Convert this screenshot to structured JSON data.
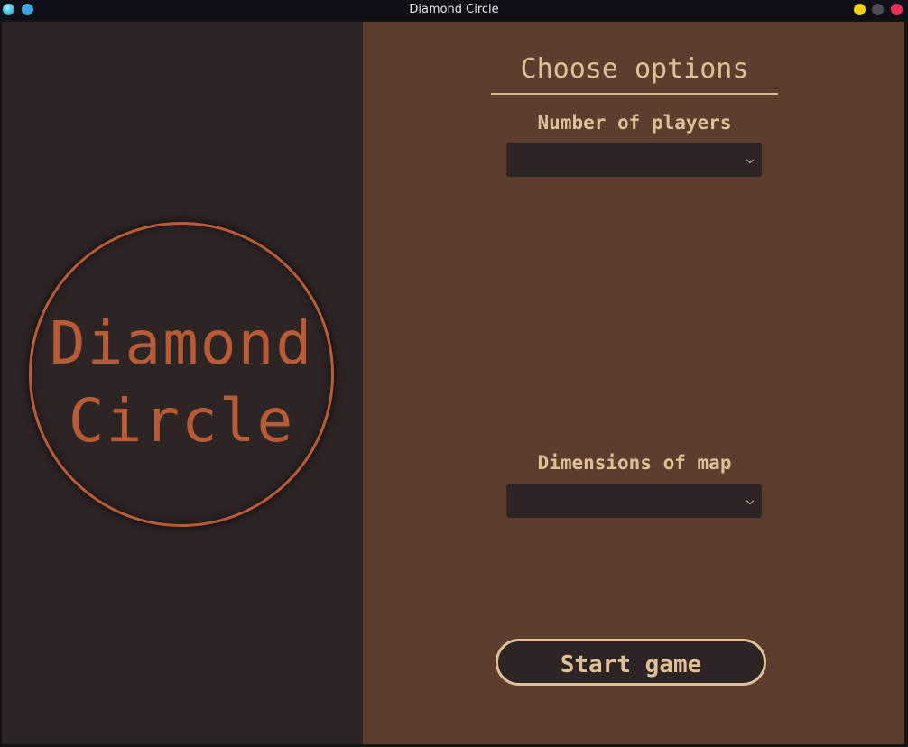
{
  "window": {
    "title": "Diamond Circle"
  },
  "logo": {
    "line1": "Diamond",
    "line2": "Circle"
  },
  "options": {
    "heading": "Choose options",
    "players": {
      "label": "Number of players",
      "value": ""
    },
    "dimensions": {
      "label": "Dimensions of map",
      "value": ""
    }
  },
  "actions": {
    "start_label": "Start game"
  },
  "colors": {
    "dark_panel": "#2d2424",
    "brown_panel": "#5c3d2e",
    "accent_orange": "#b85c38",
    "accent_tan": "#e0c097"
  },
  "icons": {
    "titlebar": [
      "app-icon",
      "pin-icon",
      "minimize-icon",
      "maximize-icon",
      "close-icon"
    ],
    "select": "chevron-down-icon"
  }
}
